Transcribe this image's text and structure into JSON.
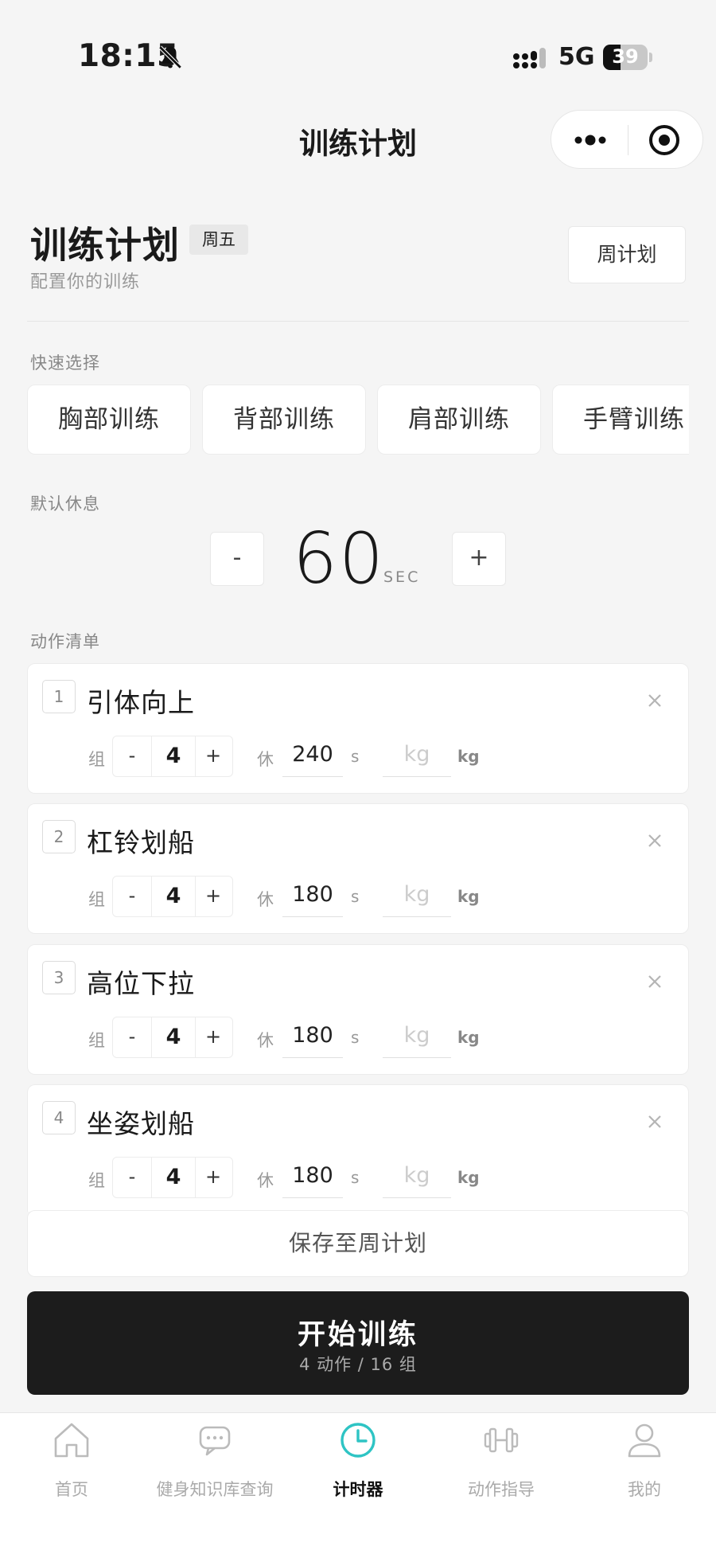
{
  "status": {
    "time": "18:15",
    "network": "5G",
    "battery": "39",
    "battery_level": 0.39
  },
  "nav": {
    "title": "训练计划"
  },
  "header": {
    "title": "训练计划",
    "day_badge": "周五",
    "subtitle": "配置你的训练",
    "week_plan_button": "周计划"
  },
  "quick_select": {
    "label": "快速选择",
    "chips": [
      "胸部训练",
      "背部训练",
      "肩部训练",
      "手臂训练"
    ]
  },
  "default_rest": {
    "label": "默认休息",
    "minus": "-",
    "value": "60",
    "unit": "SEC",
    "plus": "+"
  },
  "exercise_list": {
    "label": "动作清单",
    "sets_label": "组",
    "rest_label": "休",
    "rest_unit": "s",
    "kg_placeholder": "kg",
    "kg_unit": "kg",
    "minus": "-",
    "plus": "+",
    "items": [
      {
        "index": "1",
        "name": "引体向上",
        "sets": "4",
        "rest": "240"
      },
      {
        "index": "2",
        "name": "杠铃划船",
        "sets": "4",
        "rest": "180"
      },
      {
        "index": "3",
        "name": "高位下拉",
        "sets": "4",
        "rest": "180"
      },
      {
        "index": "4",
        "name": "坐姿划船",
        "sets": "4",
        "rest": "180"
      }
    ]
  },
  "save_button": "保存至周计划",
  "start_button": {
    "label": "开始训练",
    "summary": "4 动作 / 16 组"
  },
  "tabbar": {
    "active_color": "#2ec4c4",
    "items": [
      {
        "label": "首页",
        "icon": "home-icon"
      },
      {
        "label": "健身知识库查询",
        "icon": "chat-icon"
      },
      {
        "label": "计时器",
        "icon": "clock-icon"
      },
      {
        "label": "动作指导",
        "icon": "dumbbell-icon"
      },
      {
        "label": "我的",
        "icon": "user-icon"
      }
    ]
  }
}
